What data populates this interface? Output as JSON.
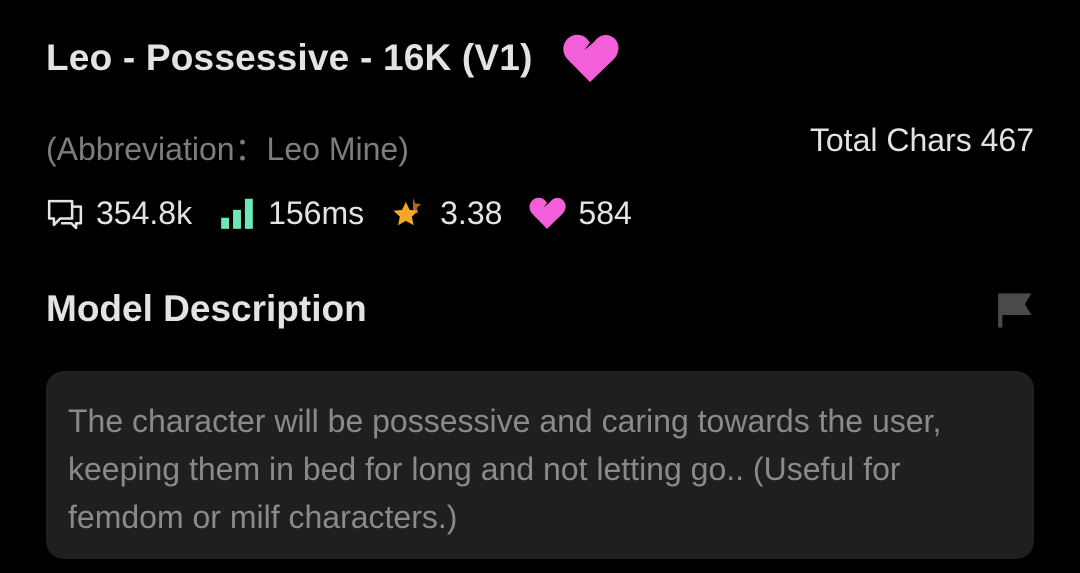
{
  "model": {
    "title": "Leo - Possessive - 16K (V1)",
    "abbreviation": "(Abbreviation：Leo Mine)",
    "total_chars": "Total Chars 467"
  },
  "stats": {
    "chats": "354.8k",
    "latency": "156ms",
    "rating": "3.38",
    "favorites": "584"
  },
  "description": {
    "heading": "Model Description",
    "text": "The character will be possessive and caring towards the user, keeping them in bed for long and not letting go.. (Useful for femdom or milf characters.)"
  },
  "icons": {
    "favorite": "heart-icon",
    "chats": "chat-bubble-icon",
    "latency": "signal-bars-icon",
    "rating": "star-icon",
    "favorites": "heart-icon",
    "report": "flag-icon"
  },
  "colors": {
    "background": "#000000",
    "heart": "#f25fd8",
    "signal": "#6ee7b7",
    "star": "#f5a623",
    "description_box": "#1f1f1f"
  }
}
